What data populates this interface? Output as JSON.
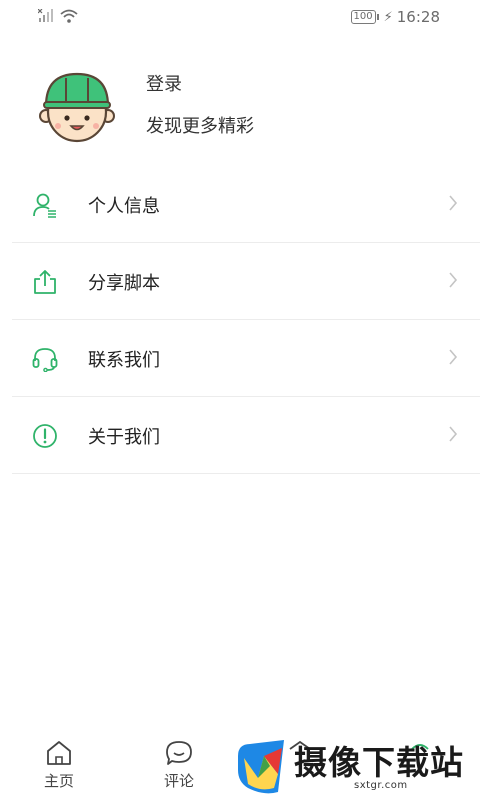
{
  "status_bar": {
    "battery": "100",
    "time": "16:28"
  },
  "profile": {
    "login": "登录",
    "discover": "发现更多精彩"
  },
  "menu": [
    {
      "label": "个人信息",
      "icon": "user-info-icon"
    },
    {
      "label": "分享脚本",
      "icon": "share-icon"
    },
    {
      "label": "联系我们",
      "icon": "headset-icon"
    },
    {
      "label": "关于我们",
      "icon": "info-alert-icon"
    }
  ],
  "tabs": [
    {
      "label": "主页",
      "icon": "home-icon"
    },
    {
      "label": "评论",
      "icon": "chat-bubble-icon"
    }
  ],
  "watermark": {
    "text": "摄像下载站",
    "url": "sxtgr.com"
  },
  "colors": {
    "accent": "#2fb36a",
    "avatar_helmet": "#3fc27a",
    "text": "#333333",
    "divider": "#ececec"
  }
}
